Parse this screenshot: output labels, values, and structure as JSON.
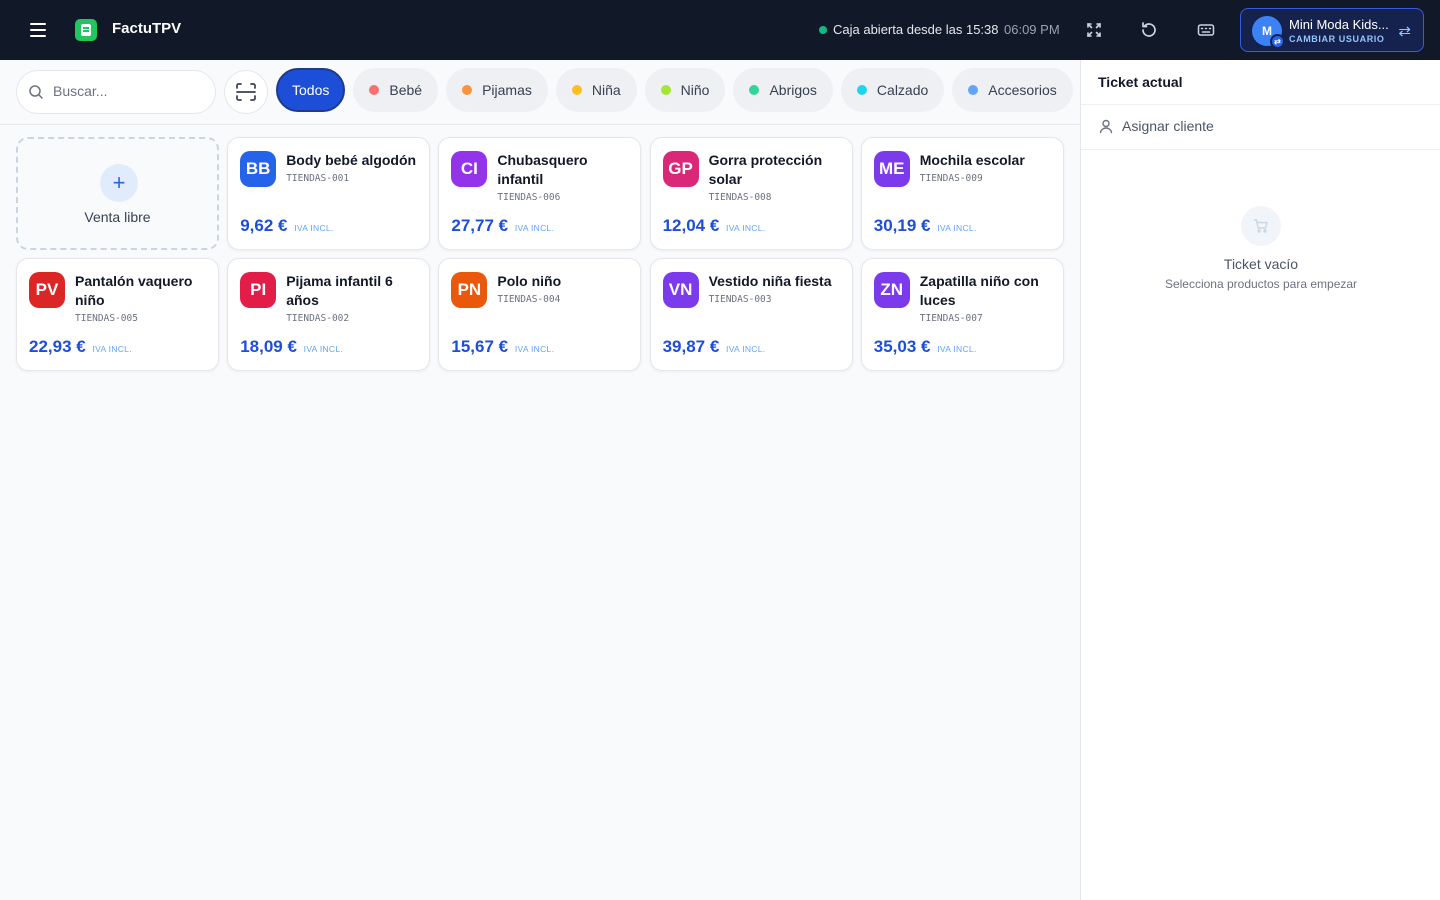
{
  "app": {
    "title": "FactuTPV"
  },
  "header": {
    "status_text": "Caja abierta desde las 15:38",
    "status_color": "#10b981",
    "clock": "06:09 PM",
    "icons": [
      "fullscreen-icon",
      "refresh-icon",
      "keyboard-icon"
    ],
    "user": {
      "initial": "M",
      "name": "Mini Moda Kids...",
      "action": "CAMBIAR USUARIO"
    }
  },
  "search": {
    "placeholder": "Buscar...",
    "value": ""
  },
  "categories": [
    {
      "label": "Todos",
      "active": true,
      "color": ""
    },
    {
      "label": "Bebé",
      "active": false,
      "color": "#f87171"
    },
    {
      "label": "Pijamas",
      "active": false,
      "color": "#fb923c"
    },
    {
      "label": "Niña",
      "active": false,
      "color": "#fbbf24"
    },
    {
      "label": "Niño",
      "active": false,
      "color": "#a3e635"
    },
    {
      "label": "Abrigos",
      "active": false,
      "color": "#34d399"
    },
    {
      "label": "Calzado",
      "active": false,
      "color": "#22d3ee"
    },
    {
      "label": "Accesorios",
      "active": false,
      "color": "#60a5fa"
    }
  ],
  "free_sale": {
    "label": "Venta libre"
  },
  "price_suffix": "IVA INCL.",
  "products": [
    {
      "initials": "BB",
      "name": "Body bebé algodón",
      "sku": "TIENDAS-001",
      "price": "9,62 €",
      "color": "#2563eb"
    },
    {
      "initials": "CI",
      "name": "Chubasquero infantil",
      "sku": "TIENDAS-006",
      "price": "27,77 €",
      "color": "#9333ea"
    },
    {
      "initials": "GP",
      "name": "Gorra protección solar",
      "sku": "TIENDAS-008",
      "price": "12,04 €",
      "color": "#db2777"
    },
    {
      "initials": "ME",
      "name": "Mochila escolar",
      "sku": "TIENDAS-009",
      "price": "30,19 €",
      "color": "#7c3aed"
    },
    {
      "initials": "PV",
      "name": "Pantalón vaquero niño",
      "sku": "TIENDAS-005",
      "price": "22,93 €",
      "color": "#dc2626"
    },
    {
      "initials": "PI",
      "name": "Pijama infantil 6 años",
      "sku": "TIENDAS-002",
      "price": "18,09 €",
      "color": "#e11d48"
    },
    {
      "initials": "PN",
      "name": "Polo niño",
      "sku": "TIENDAS-004",
      "price": "15,67 €",
      "color": "#ea580c"
    },
    {
      "initials": "VN",
      "name": "Vestido niña fiesta",
      "sku": "TIENDAS-003",
      "price": "39,87 €",
      "color": "#7c3aed"
    },
    {
      "initials": "ZN",
      "name": "Zapatilla niño con luces",
      "sku": "TIENDAS-007",
      "price": "35,03 €",
      "color": "#7c3aed"
    }
  ],
  "ticket": {
    "title": "Ticket actual",
    "assign_label": "Asignar cliente",
    "empty_title": "Ticket vacío",
    "empty_subtitle": "Selecciona productos para empezar"
  }
}
